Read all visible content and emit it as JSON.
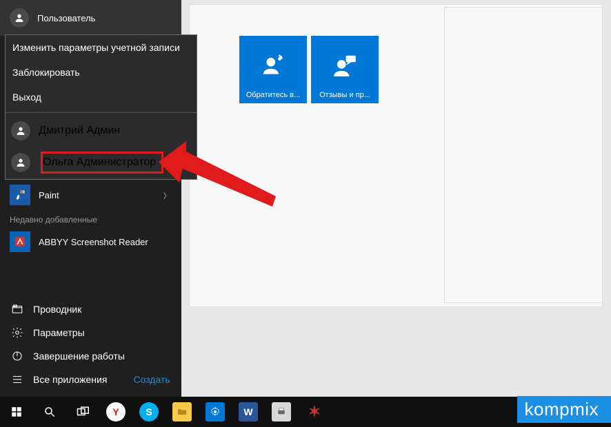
{
  "user": {
    "label": "Пользователь"
  },
  "account_menu": {
    "change": "Изменить параметры учетной записи",
    "lock": "Заблокировать",
    "signout": "Выход",
    "users": [
      {
        "name": "Дмитрий Админ"
      },
      {
        "name": "Ольга Администратор"
      }
    ]
  },
  "apps": {
    "paint": "Paint",
    "recent_header": "Недавно добавленные",
    "abbyy": "ABBYY Screenshot Reader"
  },
  "bottom": {
    "explorer": "Проводник",
    "settings": "Параметры",
    "power": "Завершение работы",
    "allapps": "Все приложения",
    "create": "Создать"
  },
  "tiles": {
    "help": "Обратитесь в...",
    "feedback": "Отзывы и пр..."
  },
  "watermark": "kompmix"
}
